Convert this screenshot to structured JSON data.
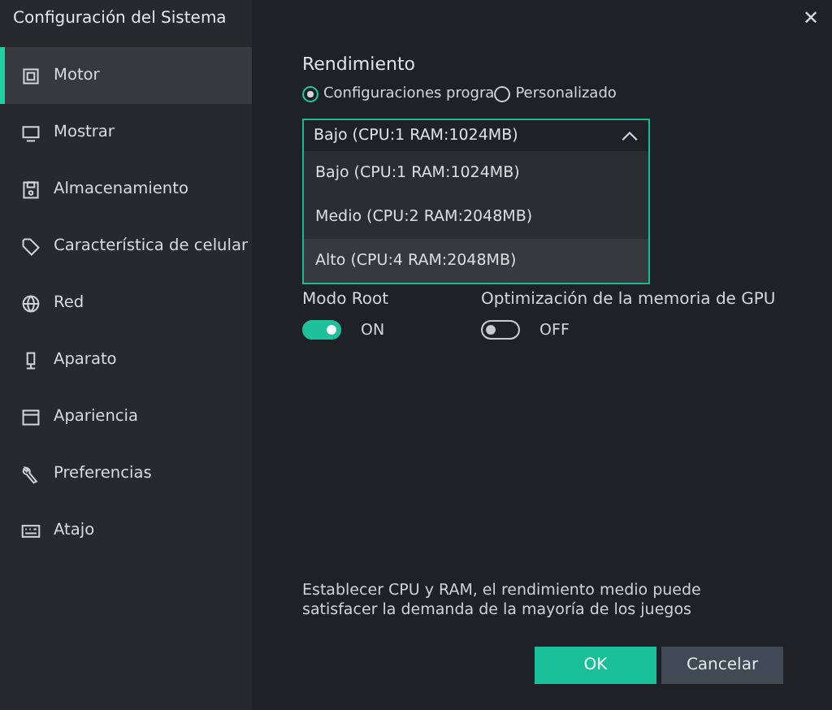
{
  "window": {
    "title": "Configuración del Sistema",
    "close": "✕"
  },
  "sidebar": {
    "items": [
      {
        "label": "Motor",
        "selected": true
      },
      {
        "label": "Mostrar",
        "selected": false
      },
      {
        "label": "Almacenamiento",
        "selected": false
      },
      {
        "label": "Característica de celular",
        "selected": false
      },
      {
        "label": "Red",
        "selected": false
      },
      {
        "label": "Aparato",
        "selected": false
      },
      {
        "label": "Apariencia",
        "selected": false
      },
      {
        "label": "Preferencias",
        "selected": false
      },
      {
        "label": "Atajo",
        "selected": false
      }
    ]
  },
  "performance": {
    "heading": "Rendimiento",
    "radios": [
      {
        "label": "Configuraciones progra",
        "selected": true
      },
      {
        "label": "Personalizado",
        "selected": false
      }
    ],
    "dropdown": {
      "value": "Bajo (CPU:1 RAM:1024MB)",
      "expanded": true,
      "options": [
        {
          "label": "Bajo (CPU:1 RAM:1024MB)",
          "highlighted": false
        },
        {
          "label": "Medio (CPU:2 RAM:2048MB)",
          "highlighted": false
        },
        {
          "label": "Alto (CPU:4 RAM:2048MB)",
          "highlighted": true
        }
      ]
    }
  },
  "toggles": [
    {
      "label": "Modo Root",
      "on": true,
      "state_text": "ON"
    },
    {
      "label": "Optimización de la memoria de GPU",
      "on": false,
      "state_text": "OFF"
    }
  ],
  "description": "Establecer CPU y RAM, el rendimiento medio puede satisfacer la demanda de la mayoría de los juegos",
  "buttons": [
    {
      "label": "OK",
      "kind": "primary"
    },
    {
      "label": "Cancelar",
      "kind": "secondary"
    }
  ]
}
